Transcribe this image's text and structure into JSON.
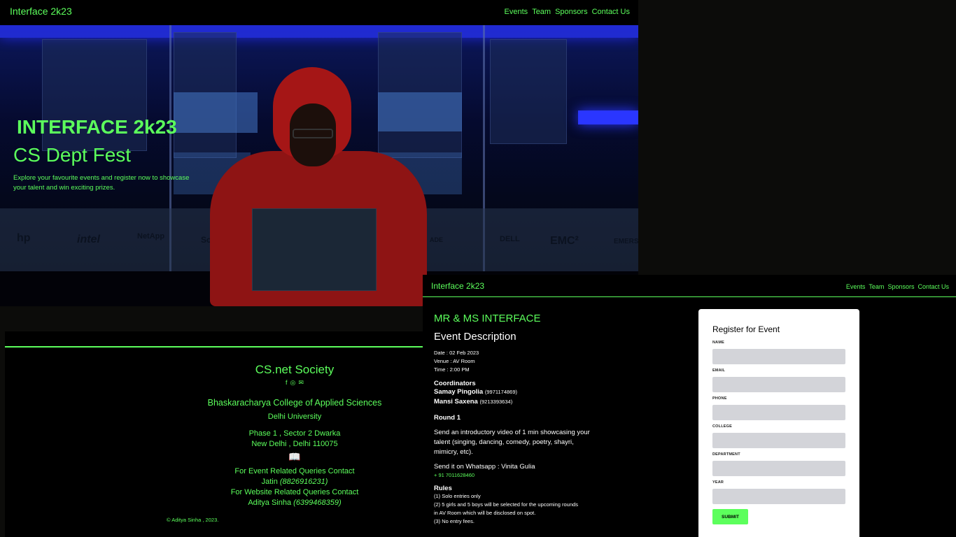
{
  "hero_page": {
    "nav": {
      "brand": "Interface 2k23",
      "links": [
        "Events",
        "Team",
        "Sponsors",
        "Contact Us"
      ]
    },
    "hero": {
      "title": "INTERFACE 2k23",
      "subtitle": "CS Dept Fest",
      "description": "Explore your favourite events and register now to showcase your talent and win exciting prizes."
    },
    "background_logos": [
      "hp",
      "intel",
      "NetApp",
      "Sch",
      "ADE",
      "DELL",
      "EMC²",
      "EMERS"
    ]
  },
  "footer": {
    "society": "CS.net Society",
    "social_icons": [
      "facebook-icon",
      "instagram-icon",
      "mail-icon"
    ],
    "college": "Bhaskaracharya College of Applied Sciences",
    "university": "Delhi University",
    "address_line1": "Phase 1 , Sector 2 Dwarka",
    "address_line2": "New Delhi , Delhi 110075",
    "book_icon": "📖",
    "event_query_label": "For Event Related Queries Contact",
    "event_contact_name": "Jatin",
    "event_contact_phone": "(8826916231)",
    "website_query_label": "For Website Related Queries Contact",
    "website_contact_name": "Aditya Sinha",
    "website_contact_phone": "(6399468359)",
    "copyright": "© Aditya Sinha , 2023."
  },
  "event_page": {
    "nav": {
      "brand": "Interface 2k23",
      "links": [
        "Events",
        "Team",
        "Sponsors",
        "Contact Us"
      ]
    },
    "event": {
      "title": "MR & MS INTERFACE",
      "description_heading": "Event Description",
      "date": "Date : 02 Feb 2023",
      "venue": "Venue : AV Room",
      "time": "Time : 2:00 PM",
      "coordinators_heading": "Coordinators",
      "coordinators": [
        {
          "name": "Samay Pingolia",
          "phone": "(9971174869)"
        },
        {
          "name": "Mansi Saxena",
          "phone": "(9213393634)"
        }
      ],
      "round_heading": "Round 1",
      "round_text": "Send an introductory video of 1 min showcasing your talent (singing, dancing, comedy, poetry, shayri, mimicry, etc).",
      "whatsapp_text": "Send it on Whatsapp : Vinita Gulia",
      "whatsapp_phone": "+ 91 7011628460",
      "rules_heading": "Rules",
      "rules": [
        "(1) Solo entries only",
        "(2) 5 girls and 5 boys will be selected for the upcoming rounds",
        "in AV Room which will be disclosed on spot.",
        "(3) No entry fees."
      ]
    },
    "registration": {
      "title": "Register for Event",
      "fields": [
        {
          "label": "NAME",
          "value": ""
        },
        {
          "label": "EMAIL",
          "value": ""
        },
        {
          "label": "PHONE",
          "value": ""
        },
        {
          "label": "COLLEGE",
          "value": ""
        },
        {
          "label": "DEPARTMENT",
          "value": ""
        },
        {
          "label": "YEAR",
          "value": ""
        }
      ],
      "submit_label": "SUBMIT"
    }
  },
  "colors": {
    "accent": "#5cff5c",
    "background": "#000000",
    "input_bg": "#d3d4d9"
  }
}
